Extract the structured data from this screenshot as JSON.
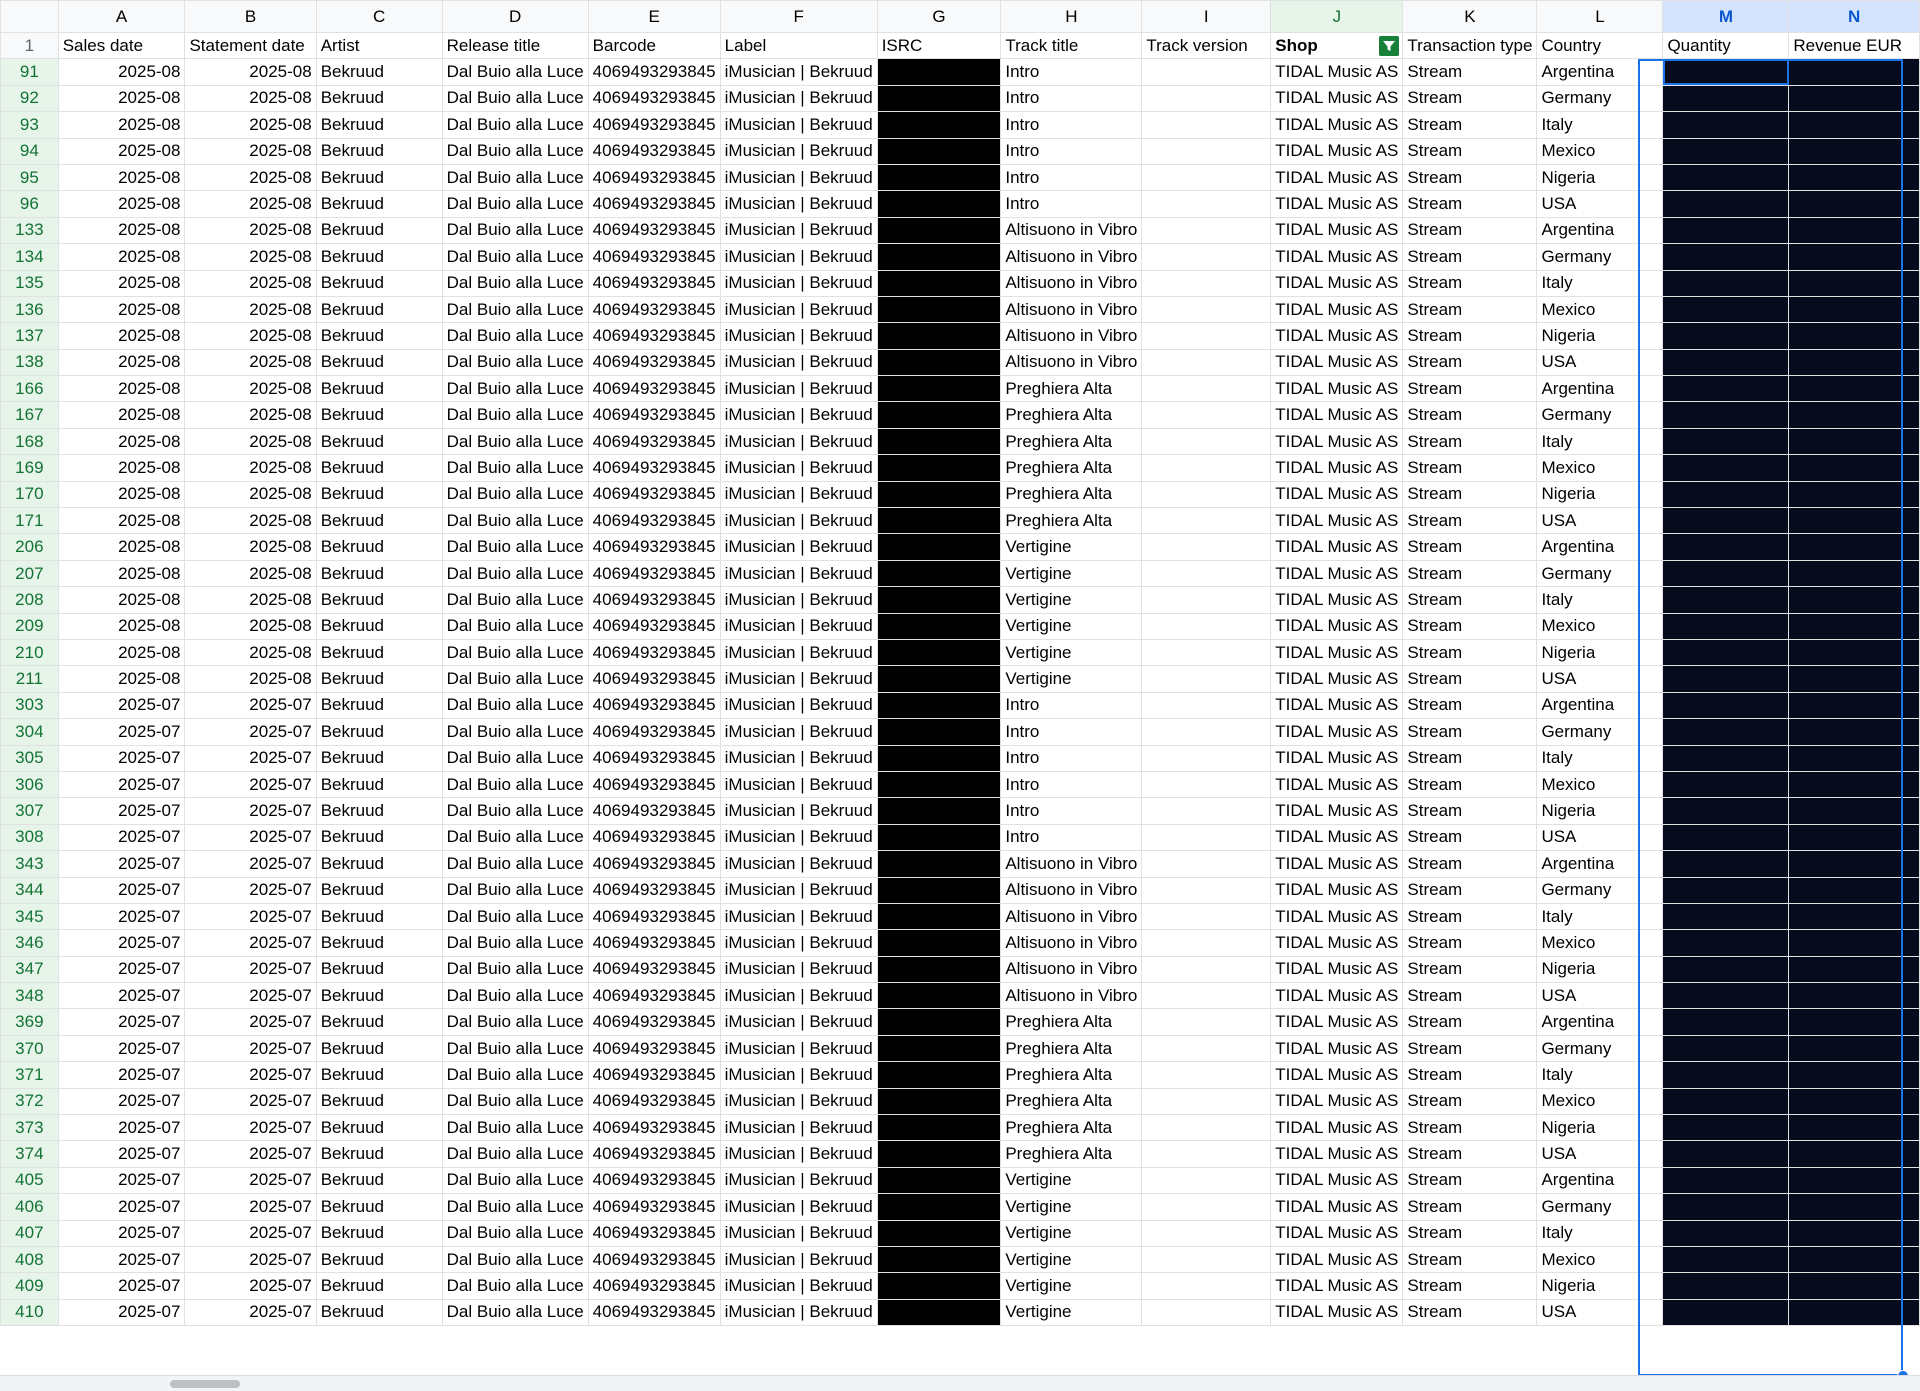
{
  "columns": [
    "A",
    "B",
    "C",
    "D",
    "E",
    "F",
    "G",
    "H",
    "I",
    "J",
    "K",
    "L",
    "M",
    "N"
  ],
  "headers": [
    "Sales date",
    "Statement date",
    "Artist",
    "Release title",
    "Barcode",
    "Label",
    "ISRC",
    "Track title",
    "Track version",
    "Shop",
    "Transaction type",
    "Country",
    "Quantity",
    "Revenue EUR"
  ],
  "header_row_number": "1",
  "filter_icon": "filter-icon",
  "colors": {
    "selection": "#1a73e8",
    "filter_green": "#188038",
    "selected_fill": "#060b1e",
    "redaction": "#000000"
  },
  "row_numbers": [
    "91",
    "92",
    "93",
    "94",
    "95",
    "96",
    "133",
    "134",
    "135",
    "136",
    "137",
    "138",
    "166",
    "167",
    "168",
    "169",
    "170",
    "171",
    "206",
    "207",
    "208",
    "209",
    "210",
    "211",
    "303",
    "304",
    "305",
    "306",
    "307",
    "308",
    "343",
    "344",
    "345",
    "346",
    "347",
    "348",
    "369",
    "370",
    "371",
    "372",
    "373",
    "374",
    "405",
    "406",
    "407",
    "408",
    "409",
    "410"
  ],
  "common": {
    "artist": "Bekruud",
    "release_title": "Dal Buio alla Luce",
    "barcode": "4069493293845",
    "label": "iMusician | Bekruud",
    "shop": "TIDAL Music AS",
    "transaction_type": "Stream"
  },
  "dates": [
    "2025-08",
    "2025-08",
    "2025-08",
    "2025-08",
    "2025-08",
    "2025-08",
    "2025-08",
    "2025-08",
    "2025-08",
    "2025-08",
    "2025-08",
    "2025-08",
    "2025-08",
    "2025-08",
    "2025-08",
    "2025-08",
    "2025-08",
    "2025-08",
    "2025-08",
    "2025-08",
    "2025-08",
    "2025-08",
    "2025-08",
    "2025-08",
    "2025-07",
    "2025-07",
    "2025-07",
    "2025-07",
    "2025-07",
    "2025-07",
    "2025-07",
    "2025-07",
    "2025-07",
    "2025-07",
    "2025-07",
    "2025-07",
    "2025-07",
    "2025-07",
    "2025-07",
    "2025-07",
    "2025-07",
    "2025-07",
    "2025-07",
    "2025-07",
    "2025-07",
    "2025-07",
    "2025-07",
    "2025-07"
  ],
  "tracks": [
    "Intro",
    "Intro",
    "Intro",
    "Intro",
    "Intro",
    "Intro",
    "Altisuono in Vibro",
    "Altisuono in Vibro",
    "Altisuono in Vibro",
    "Altisuono in Vibro",
    "Altisuono in Vibro",
    "Altisuono in Vibro",
    "Preghiera Alta",
    "Preghiera Alta",
    "Preghiera Alta",
    "Preghiera Alta",
    "Preghiera Alta",
    "Preghiera Alta",
    "Vertigine",
    "Vertigine",
    "Vertigine",
    "Vertigine",
    "Vertigine",
    "Vertigine",
    "Intro",
    "Intro",
    "Intro",
    "Intro",
    "Intro",
    "Intro",
    "Altisuono in Vibro",
    "Altisuono in Vibro",
    "Altisuono in Vibro",
    "Altisuono in Vibro",
    "Altisuono in Vibro",
    "Altisuono in Vibro",
    "Preghiera Alta",
    "Preghiera Alta",
    "Preghiera Alta",
    "Preghiera Alta",
    "Preghiera Alta",
    "Preghiera Alta",
    "Vertigine",
    "Vertigine",
    "Vertigine",
    "Vertigine",
    "Vertigine",
    "Vertigine"
  ],
  "countries": [
    "Argentina",
    "Germany",
    "Italy",
    "Mexico",
    "Nigeria",
    "USA",
    "Argentina",
    "Germany",
    "Italy",
    "Mexico",
    "Nigeria",
    "USA",
    "Argentina",
    "Germany",
    "Italy",
    "Mexico",
    "Nigeria",
    "USA",
    "Argentina",
    "Germany",
    "Italy",
    "Mexico",
    "Nigeria",
    "USA",
    "Argentina",
    "Germany",
    "Italy",
    "Mexico",
    "Nigeria",
    "USA",
    "Argentina",
    "Germany",
    "Italy",
    "Mexico",
    "Nigeria",
    "USA",
    "Argentina",
    "Germany",
    "Italy",
    "Mexico",
    "Nigeria",
    "USA",
    "Argentina",
    "Germany",
    "Italy",
    "Mexico",
    "Nigeria",
    "USA"
  ]
}
